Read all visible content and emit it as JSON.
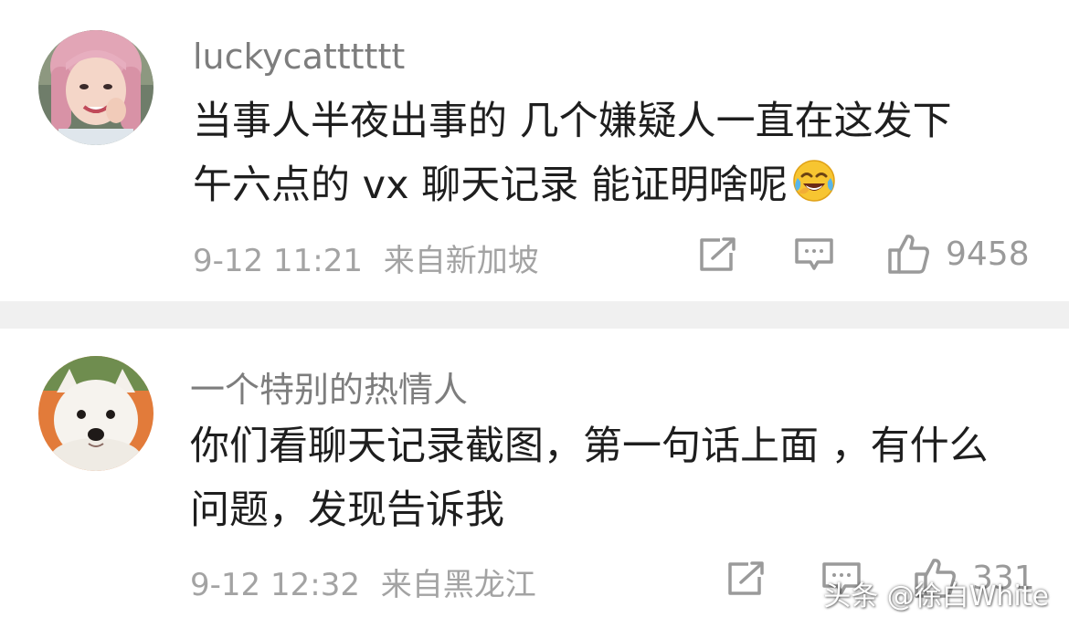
{
  "comments": [
    {
      "username": "luckycatttttt",
      "text_lines": [
        "当事人半夜出事的 几个嫌疑人一直在这发下",
        "午六点的 vx 聊天记录 能证明啥呢"
      ],
      "emoji": "tears-of-joy-emoji",
      "date": "9-12 11:21",
      "location": "来自新加坡",
      "like_count": "9458",
      "avatar": "avatar-pink-hair-girl"
    },
    {
      "username": "一个特别的热情人",
      "text_lines": [
        "你们看聊天记录截图，第一句话上面 ，有什么",
        "问题，发现告诉我"
      ],
      "date": "9-12 12:32",
      "location": "来自黑龙江",
      "like_count": "331",
      "avatar": "avatar-white-dog"
    }
  ],
  "icons": {
    "share": "share-icon",
    "reply": "comment-icon",
    "like": "thumbs-up-icon"
  },
  "colors": {
    "username": "#7d7d7d",
    "text": "#1e1e1e",
    "meta": "#a3a3a3",
    "separator": "#f0f0f0"
  },
  "watermark": "头条 @徐白White"
}
